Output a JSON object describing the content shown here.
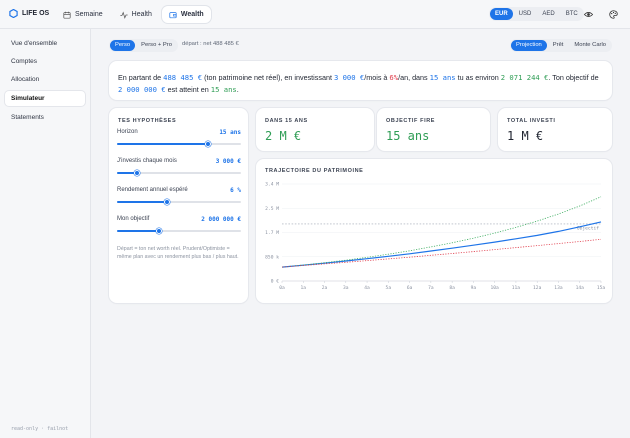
{
  "app": {
    "name": "LIFE OS"
  },
  "nav": {
    "tabs": [
      {
        "label": "Semaine",
        "icon": "calendar-icon"
      },
      {
        "label": "Health",
        "icon": "activity-icon"
      },
      {
        "label": "Wealth",
        "icon": "wallet-icon",
        "active": true
      }
    ]
  },
  "currency": {
    "options": [
      "EUR",
      "USD",
      "AED",
      "BTC"
    ],
    "selected": "EUR"
  },
  "header_icons": [
    "eye-icon",
    "palette-icon"
  ],
  "sidebar": {
    "items": [
      {
        "label": "Vue d'ensemble"
      },
      {
        "label": "Comptes"
      },
      {
        "label": "Allocation"
      },
      {
        "label": "Simulateur",
        "active": true
      },
      {
        "label": "Statements"
      }
    ],
    "footer": "read-only · failnot"
  },
  "profile": {
    "options": [
      "Perso",
      "Perso + Pro"
    ],
    "selected": "Perso",
    "depart": "départ : net 488 485 €"
  },
  "mode": {
    "options": [
      "Projection",
      "Prêt",
      "Monte Carlo"
    ],
    "selected": "Projection"
  },
  "summary": {
    "p1": "En partant de ",
    "start": "488 485 €",
    "p2": " (ton patrimoine net réel), en investissant ",
    "monthly": "3 000 €",
    "p3": "/mois à ",
    "rate": "6%",
    "p4": "/an, dans ",
    "years": "15 ans",
    "p5": " tu as environ ",
    "result": "2 071 244 €",
    "p6": ". Ton objectif de ",
    "goal": "2 000 000 €",
    "p7": " est atteint en ",
    "reached": "15 ans",
    "p8": "."
  },
  "hypotheses": {
    "title": "TES HYPOTHÈSES",
    "rows": [
      {
        "label": "Horizon",
        "value": "15 ans",
        "fraction": 0.73
      },
      {
        "label": "J'investis chaque mois",
        "value": "3 000 €",
        "fraction": 0.16
      },
      {
        "label": "Rendement annuel espéré",
        "value": "6 %",
        "fraction": 0.4
      },
      {
        "label": "Mon objectif",
        "value": "2 000 000 €",
        "fraction": 0.34
      }
    ],
    "note": "Départ = ton net worth réel. Prudent/Optimiste = même plan avec un rendement plus bas / plus haut."
  },
  "kpis": [
    {
      "label": "DANS 15 ANS",
      "value": "2 M €",
      "color": "#2f9d55"
    },
    {
      "label": "OBJECTIF FIRE",
      "value": "15 ans",
      "color": "#2f9d55"
    },
    {
      "label": "TOTAL INVESTI",
      "value": "1 M €",
      "color": "#1f2430"
    }
  ],
  "chart_data": {
    "type": "line",
    "title": "TRAJECTOIRE DU PATRIMOINE",
    "x": [
      "0a",
      "1a",
      "2a",
      "3a",
      "4a",
      "5a",
      "6a",
      "7a",
      "8a",
      "9a",
      "10a",
      "11a",
      "12a",
      "13a",
      "14a",
      "15a"
    ],
    "y_ticks": [
      "0 €",
      "850 k",
      "1.7 M",
      "2.5 M",
      "3.4 M"
    ],
    "ylim": [
      0,
      3400000
    ],
    "goal": {
      "value": 2000000,
      "label": "Objectif"
    },
    "series": [
      {
        "values": [
          488485,
          555000,
          625000,
          700000,
          780000,
          865000,
          955000,
          1050000,
          1150000,
          1255000,
          1365000,
          1480000,
          1600000,
          1740000,
          1900000,
          2071244
        ],
        "color": "#1e74e8",
        "style": "solid"
      },
      {
        "values": [
          488485,
          560000,
          640000,
          730000,
          830000,
          940000,
          1060000,
          1195000,
          1340000,
          1500000,
          1680000,
          1880000,
          2100000,
          2350000,
          2630000,
          2950000
        ],
        "color": "#3fae62",
        "style": "dotted"
      },
      {
        "values": [
          488485,
          545000,
          600000,
          655000,
          715000,
          775000,
          835000,
          900000,
          965000,
          1030000,
          1100000,
          1170000,
          1240000,
          1310000,
          1385000,
          1460000
        ],
        "color": "#e03b4a",
        "style": "dotted"
      }
    ]
  }
}
